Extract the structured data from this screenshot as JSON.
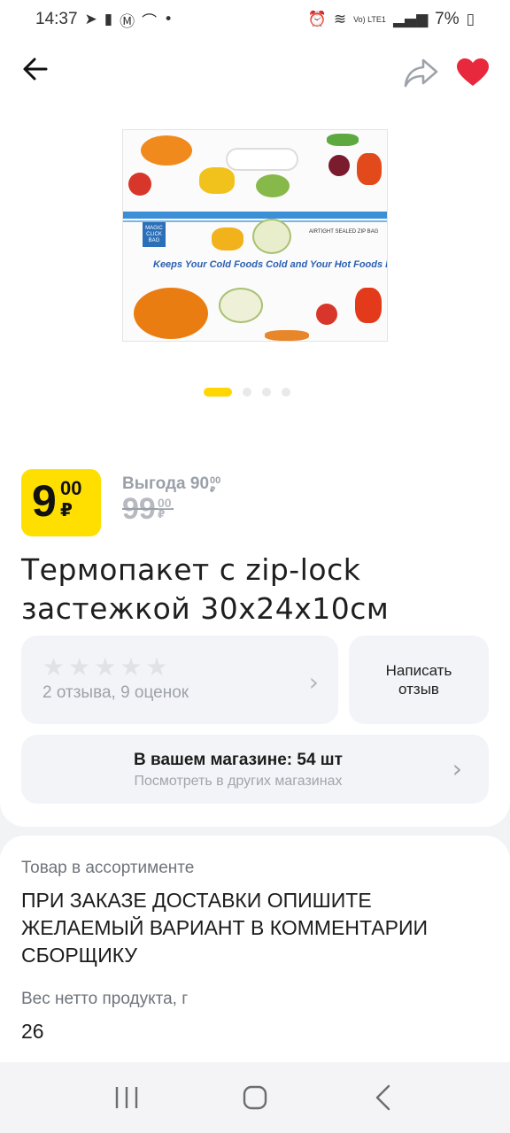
{
  "status_bar": {
    "time": "14:37",
    "battery": "7%",
    "network": "Vo) LTE1"
  },
  "header": {
    "back_icon": "arrow-left-icon",
    "share_icon": "share-icon",
    "favorite_icon": "heart-icon",
    "favorite_color": "#e8283c"
  },
  "product_image": {
    "tagline": "Keeps Your Cold Foods Cold and Your Hot Foods Hot.",
    "brand": "MAGIC CLICK BAG",
    "small_text": "AIRTIGHT SEALED ZIP BAG"
  },
  "gallery": {
    "total": 4,
    "active_index": 0
  },
  "price": {
    "main": "9",
    "cents": "00",
    "currency": "₽",
    "badge_color": "#ffdf00",
    "saving_label": "Выгода 90",
    "saving_cents": "00",
    "saving_currency": "₽",
    "old_price": "99",
    "old_cents": "00",
    "old_currency": "₽"
  },
  "product": {
    "title": "Термопакет с zip-lock застежкой 30x24x10см"
  },
  "reviews": {
    "stars_filled": 0,
    "stars_total": 5,
    "summary": "2 отзыва, 9 оценок",
    "write_label": "Написать отзыв"
  },
  "store": {
    "availability": "В вашем магазине: 54 шт",
    "other_stores": "Посмотреть в других магазинах"
  },
  "info": {
    "assortment_label": "Товар в ассортименте",
    "assortment_note": "ПРИ ЗАКАЗЕ ДОСТАВКИ ОПИШИТЕ ЖЕЛАЕМЫЙ ВАРИАНТ В КОММЕНТАРИИ СБОРЩИКУ",
    "weight_label": "Вес нетто продукта, г",
    "weight_value": "26"
  },
  "nav": {
    "recents_icon": "recents-icon",
    "home_icon": "home-icon",
    "back_icon": "back-chevron-icon"
  }
}
